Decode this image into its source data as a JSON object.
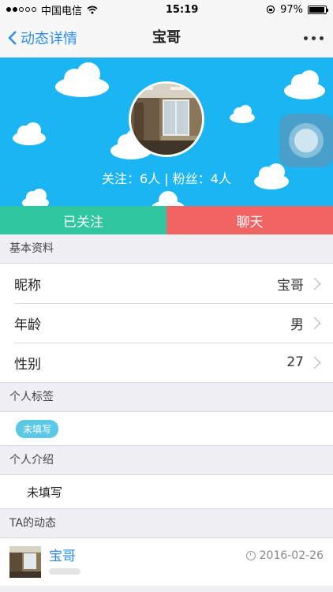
{
  "statusbar": {
    "carrier": "中国电信",
    "time": "15:19",
    "battery": "97%",
    "battery_level": 0.97
  },
  "nav": {
    "back_label": "动态详情",
    "title": "宝哥"
  },
  "profile": {
    "follow_stats": "关注：6人 | 粉丝：4人"
  },
  "actions": {
    "followed": "已关注",
    "chat": "聊天"
  },
  "basic": {
    "header": "基本资料",
    "rows": [
      {
        "label": "昵称",
        "value": "宝哥"
      },
      {
        "label": "年龄",
        "value": "男"
      },
      {
        "label": "性别",
        "value": "27"
      }
    ]
  },
  "tags": {
    "header": "个人标签",
    "tag": "未填写"
  },
  "intro": {
    "header": "个人介绍",
    "text": "未填写"
  },
  "feed": {
    "header": "TA的动态",
    "name": "宝哥",
    "date": "2016-02-26"
  },
  "colors": {
    "hero": "#1ab5f2",
    "followed": "#2fc6a0",
    "chat": "#f06464",
    "accent": "#2a8cf0"
  }
}
